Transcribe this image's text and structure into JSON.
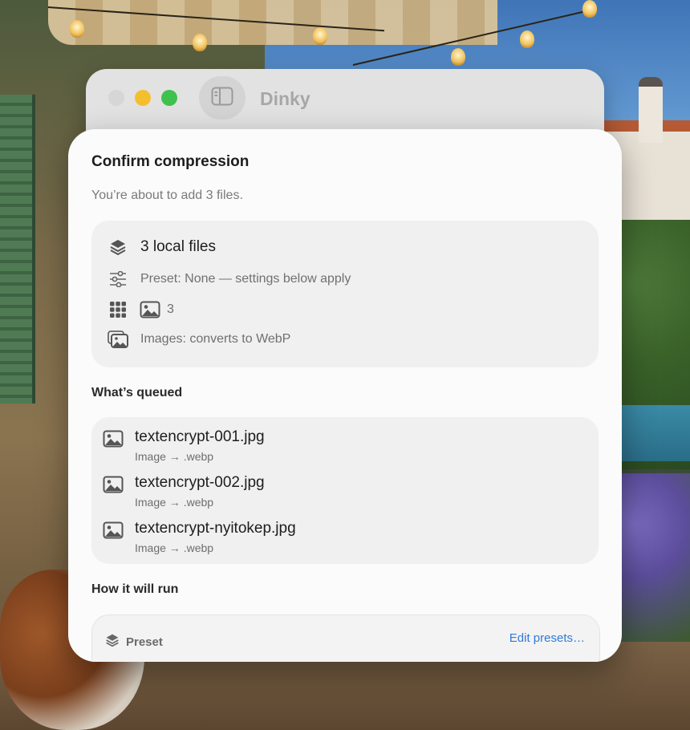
{
  "window": {
    "title": "Dinky",
    "traffic_lights": {
      "close": "#d6d6d6",
      "minimize": "#f4bf2e",
      "maximize": "#3fc14e"
    },
    "sidebar_toggle_icon": "sidebar-icon"
  },
  "dialog": {
    "title": "Confirm compression",
    "subtitle": "You’re about to add 3 files.",
    "summary": {
      "files_label": "3 local files",
      "files_icon": "stack-icon",
      "preset_text": "Preset: None — settings below apply",
      "preset_icon": "sliders-icon",
      "type_count": "3",
      "grid_icon": "grid-icon",
      "image_type_icon": "photo-icon",
      "conversion_text": "Images: converts to WebP",
      "conversion_icon": "photos-stack-icon"
    },
    "queued": {
      "heading": "What’s queued",
      "items": [
        {
          "name": "textencrypt-001.jpg",
          "detail": "Image → .webp",
          "icon": "photo-icon"
        },
        {
          "name": "textencrypt-002.jpg",
          "detail": "Image → .webp",
          "icon": "photo-icon"
        },
        {
          "name": "textencrypt-nyitokep.jpg",
          "detail": "Image → .webp",
          "icon": "photo-icon"
        }
      ]
    },
    "run": {
      "heading": "How it will run",
      "preset_label": "Preset",
      "edit_link": "Edit presets…"
    }
  },
  "colors": {
    "accent": "#2f7bd9",
    "sheet_bg": "#fbfbfb",
    "card_bg": "#f0f0f0"
  }
}
